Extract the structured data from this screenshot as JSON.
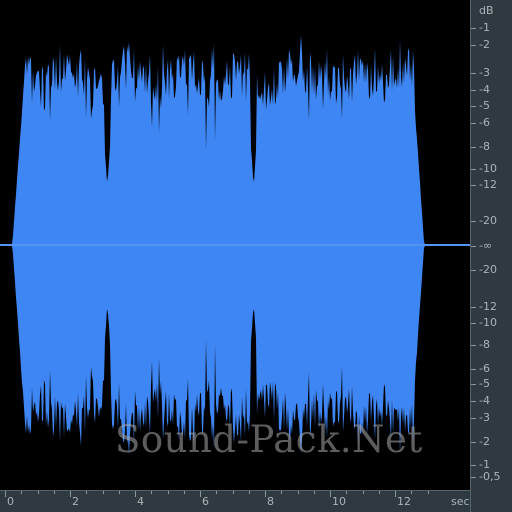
{
  "colors": {
    "waveform": "#3f86f5",
    "background": "#000000",
    "ruler_bg": "#2e3a40",
    "ruler_text": "#a9b3b8",
    "center_line": "#6aa2f5"
  },
  "watermark": "Sound-Pack.Net",
  "db_ruler": {
    "unit": "dB",
    "labels": [
      "-1",
      "-2",
      "-3",
      "-4",
      "-5",
      "-6",
      "-8",
      "-10",
      "-12",
      "-20",
      "-∞",
      "-20",
      "-12",
      "-10",
      "-8",
      "-6",
      "-5",
      "-4",
      "-3",
      "-2",
      "-1",
      "-0,5"
    ]
  },
  "time_ruler": {
    "unit": "sec",
    "labels": [
      "0",
      "2",
      "4",
      "6",
      "8",
      "10",
      "12"
    ]
  },
  "waveform": {
    "duration_sec": 14.0,
    "sound_start_sec": 0.35,
    "sound_end_sec": 12.65,
    "dips_sec": [
      3.15,
      7.65
    ]
  }
}
